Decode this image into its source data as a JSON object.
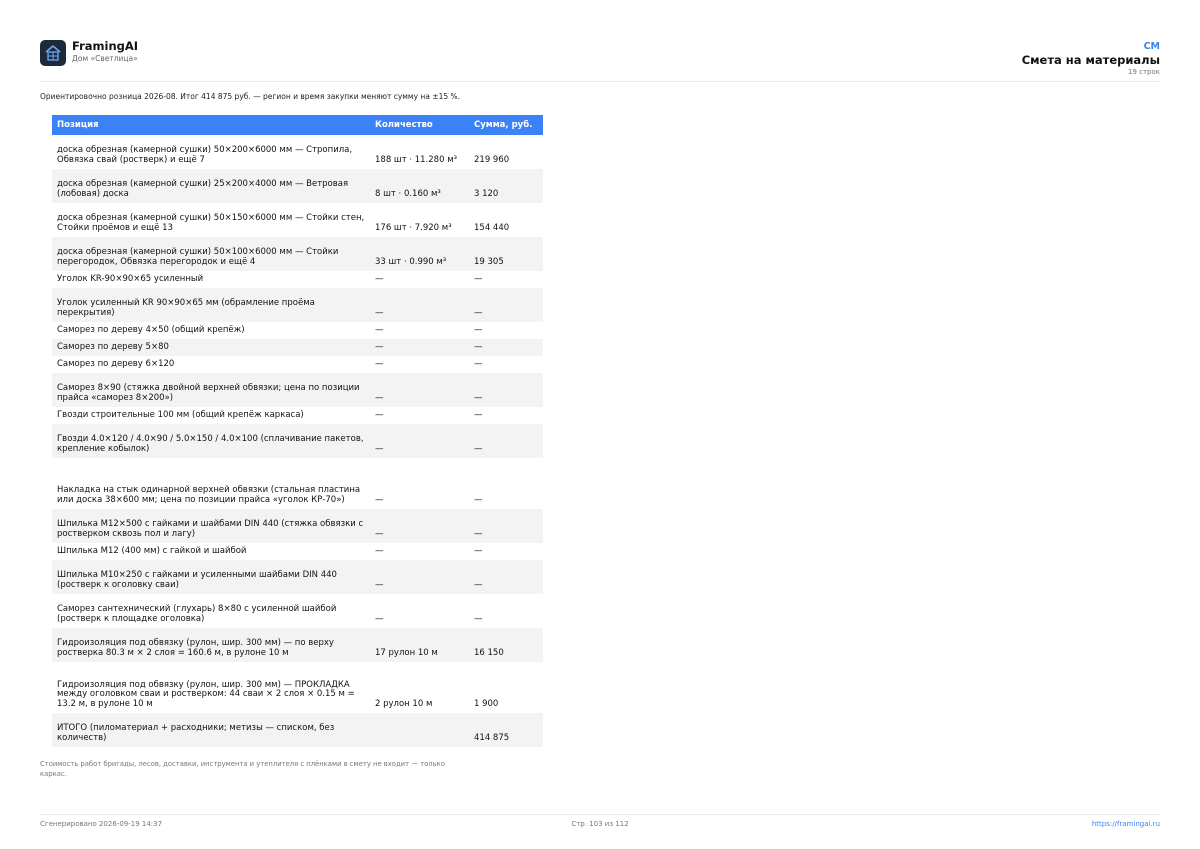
{
  "header": {
    "brand": "FramingAI",
    "project": "Дом «Светлица»",
    "doc_code": "CM",
    "doc_title": "Смета на материалы",
    "row_count": "19 строк"
  },
  "intro": "Ориентировочно розница 2026-08. Итог 414 875 руб. — регион и время закупки меняют сумму на ±15 %.",
  "table": {
    "columns": [
      "Позиция",
      "Количество",
      "Сумма, руб."
    ],
    "rows": [
      {
        "item": "доска обрезная (камерной сушки) 50×200×6000 мм — Стропила, Обвязка свай (ростверк) и ещё 7",
        "qty": "188 шт · 11.280 м³",
        "sum": "219 960"
      },
      {
        "item": "доска обрезная (камерной сушки) 25×200×4000 мм — Ветровая (лобовая) доска",
        "qty": "8 шт · 0.160 м³",
        "sum": "3 120"
      },
      {
        "item": "доска обрезная (камерной сушки) 50×150×6000 мм — Стойки стен, Стойки проёмов и ещё 13",
        "qty": "176 шт · 7.920 м³",
        "sum": "154 440"
      },
      {
        "item": "доска обрезная (камерной сушки) 50×100×6000 мм — Стойки перегородок, Обвязка перегородок и ещё 4",
        "qty": "33 шт · 0.990 м³",
        "sum": "19 305"
      },
      {
        "item": "Уголок KR-90×90×65 усиленный",
        "qty": "—",
        "sum": "—"
      },
      {
        "item": "Уголок усиленный KR 90×90×65 мм (обрамление проёма перекрытия)",
        "qty": "—",
        "sum": "—"
      },
      {
        "item": "Саморез по дереву 4×50 (общий крепёж)",
        "qty": "—",
        "sum": "—"
      },
      {
        "item": "Саморез по дереву 5×80",
        "qty": "—",
        "sum": "—"
      },
      {
        "item": "Саморез по дереву 6×120",
        "qty": "—",
        "sum": "—"
      },
      {
        "item": "Саморез 8×90 (стяжка двойной верхней обвязки; цена по позиции прайса «саморез 8×200»)",
        "qty": "—",
        "sum": "—"
      },
      {
        "item": "Гвозди строительные 100 мм (общий крепёж каркаса)",
        "qty": "—",
        "sum": "—"
      },
      {
        "item": "Гвозди 4.0×120 / 4.0×90 / 5.0×150 / 4.0×100 (сплачивание пакетов, крепление кобылок)",
        "qty": "—",
        "sum": "—"
      },
      {
        "item": "Накладка на стык одинарной верхней обвязки (стальная пластина или доска 38×600 мм; цена по позиции прайса «уголок КР-70»)",
        "qty": "—",
        "sum": "—"
      },
      {
        "item": "Шпилька М12×500 с гайками и шайбами DIN 440 (стяжка обвязки с ростверком сквозь пол и лагу)",
        "qty": "—",
        "sum": "—"
      },
      {
        "item": "Шпилька М12 (400 мм) с гайкой и шайбой",
        "qty": "—",
        "sum": "—"
      },
      {
        "item": "Шпилька М10×250 с гайками и усиленными шайбами DIN 440 (ростверк к оголовку сваи)",
        "qty": "—",
        "sum": "—"
      },
      {
        "item": "Саморез сантехнический (глухарь) 8×80 с усиленной шайбой (ростверк к площадке оголовка)",
        "qty": "—",
        "sum": "—"
      },
      {
        "item": "Гидроизоляция под обвязку (рулон, шир. 300 мм) — по верху ростверка 80.3 м × 2 слоя = 160.6 м, в рулоне 10 м",
        "qty": "17 рулон 10 м",
        "sum": "16 150"
      },
      {
        "item": "Гидроизоляция под обвязку (рулон, шир. 300 мм) — ПРОКЛАДКА между оголовком сваи и ростверком: 44 сваи × 2 слоя × 0.15 м = 13.2 м, в рулоне 10 м",
        "qty": "2 рулон 10 м",
        "sum": "1 900"
      },
      {
        "item": "ИТОГО (пиломатериал + расходники; метизы — списком, без количеств)",
        "qty": "",
        "sum": "414 875"
      }
    ]
  },
  "note": "Стоимость работ бригады, лесов, доставки, инструмента и утеплителя с плёнками в смету не входит — только каркас.",
  "footer": {
    "generated": "Сгенерировано 2026-09-19 14:37",
    "page": "Стр. 103 из 112",
    "url": "https://framingai.ru"
  },
  "colors": {
    "accent": "#3b82f6",
    "logo_bg": "#1c2a3a"
  },
  "icons": {
    "logo": "house-frame-icon"
  }
}
